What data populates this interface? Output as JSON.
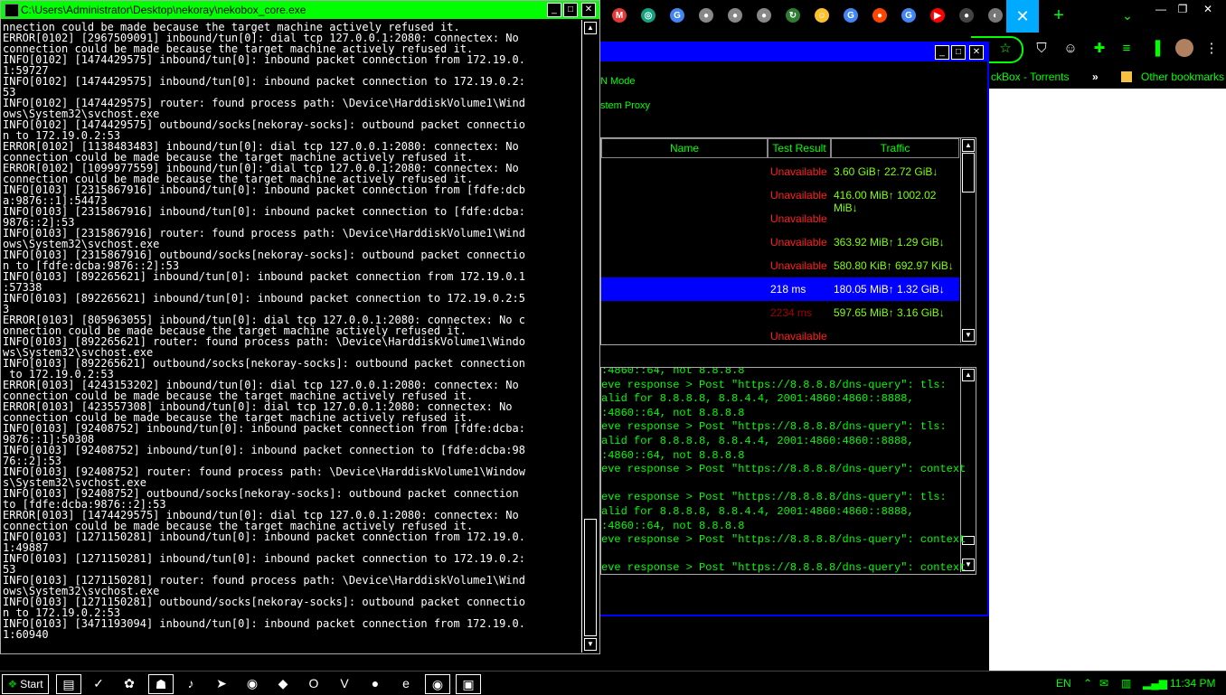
{
  "console": {
    "title": "C:\\Users\\Administrator\\Desktop\\nekoray\\nekobox_core.exe",
    "lines": [
      "nnection could be made because the target machine actively refused it.",
      "ERROR[0102] [2967509091] inbound/tun[0]: dial tcp 127.0.0.1:2080: connectex: No",
      "connection could be made because the target machine actively refused it.",
      "INFO[0102] [1474429575] inbound/tun[0]: inbound packet connection from 172.19.0.",
      "1:59727",
      "INFO[0102] [1474429575] inbound/tun[0]: inbound packet connection to 172.19.0.2:",
      "53",
      "INFO[0102] [1474429575] router: found process path: \\Device\\HarddiskVolume1\\Wind",
      "ows\\System32\\svchost.exe",
      "INFO[0102] [1474429575] outbound/socks[nekoray-socks]: outbound packet connectio",
      "n to 172.19.0.2:53",
      "ERROR[0102] [1138483483] inbound/tun[0]: dial tcp 127.0.0.1:2080: connectex: No",
      "connection could be made because the target machine actively refused it.",
      "ERROR[0102] [1099977559] inbound/tun[0]: dial tcp 127.0.0.1:2080: connectex: No",
      "connection could be made because the target machine actively refused it.",
      "INFO[0103] [2315867916] inbound/tun[0]: inbound packet connection from [fdfe:dcb",
      "a:9876::1]:54473",
      "INFO[0103] [2315867916] inbound/tun[0]: inbound packet connection to [fdfe:dcba:",
      "9876::2]:53",
      "INFO[0103] [2315867916] router: found process path: \\Device\\HarddiskVolume1\\Wind",
      "ows\\System32\\svchost.exe",
      "INFO[0103] [2315867916] outbound/socks[nekoray-socks]: outbound packet connectio",
      "n to [fdfe:dcba:9876::2]:53",
      "INFO[0103] [892265621] inbound/tun[0]: inbound packet connection from 172.19.0.1",
      ":57338",
      "INFO[0103] [892265621] inbound/tun[0]: inbound packet connection to 172.19.0.2:5",
      "3",
      "ERROR[0103] [805963055] inbound/tun[0]: dial tcp 127.0.0.1:2080: connectex: No c",
      "onnection could be made because the target machine actively refused it.",
      "INFO[0103] [892265621] router: found process path: \\Device\\HarddiskVolume1\\Windo",
      "ws\\System32\\svchost.exe",
      "INFO[0103] [892265621] outbound/socks[nekoray-socks]: outbound packet connection",
      " to 172.19.0.2:53",
      "ERROR[0103] [4243153202] inbound/tun[0]: dial tcp 127.0.0.1:2080: connectex: No",
      "connection could be made because the target machine actively refused it.",
      "ERROR[0103] [423557308] inbound/tun[0]: dial tcp 127.0.0.1:2080: connectex: No",
      "connection could be made because the target machine actively refused it.",
      "INFO[0103] [92408752] inbound/tun[0]: inbound packet connection from [fdfe:dcba:",
      "9876::1]:50308",
      "INFO[0103] [92408752] inbound/tun[0]: inbound packet connection to [fdfe:dcba:98",
      "76::2]:53",
      "INFO[0103] [92408752] router: found process path: \\Device\\HarddiskVolume1\\Window",
      "s\\System32\\svchost.exe",
      "INFO[0103] [92408752] outbound/socks[nekoray-socks]: outbound packet connection",
      "to [fdfe:dcba:9876::2]:53",
      "ERROR[0103] [1474429575] inbound/tun[0]: dial tcp 127.0.0.1:2080: connectex: No",
      "connection could be made because the target machine actively refused it.",
      "INFO[0103] [1271150281] inbound/tun[0]: inbound packet connection from 172.19.0.",
      "1:49887",
      "INFO[0103] [1271150281] inbound/tun[0]: inbound packet connection to 172.19.0.2:",
      "53",
      "INFO[0103] [1271150281] router: found process path: \\Device\\HarddiskVolume1\\Wind",
      "ows\\System32\\svchost.exe",
      "INFO[0103] [1271150281] outbound/socks[nekoray-socks]: outbound packet connectio",
      "n to 172.19.0.2:53",
      "INFO[0103] [3471193094] inbound/tun[0]: inbound packet connection from 172.19.0.",
      "1:60940"
    ]
  },
  "neko": {
    "mode_label": "N Mode",
    "proxy_label": "stem Proxy",
    "columns": [
      "Name",
      "Test Result",
      "Traffic"
    ],
    "rows": [
      {
        "result": "Unavailable",
        "result_color": "#ff2020",
        "traffic": "3.60 GiB↑ 22.72 GiB↓",
        "selected": false
      },
      {
        "result": "Unavailable",
        "result_color": "#ff2020",
        "traffic": "416.00 MiB↑ 1002.02 MiB↓",
        "selected": false
      },
      {
        "result": "Unavailable",
        "result_color": "#ff2020",
        "traffic": "",
        "selected": false
      },
      {
        "result": "Unavailable",
        "result_color": "#ff2020",
        "traffic": "363.92 MiB↑ 1.29 GiB↓",
        "selected": false
      },
      {
        "result": "Unavailable",
        "result_color": "#ff2020",
        "traffic": "580.80 KiB↑ 692.97 KiB↓",
        "selected": false
      },
      {
        "result": "218 ms",
        "result_color": "#ffffff",
        "traffic": "180.05 MiB↑ 1.32 GiB↓",
        "selected": true
      },
      {
        "result": "2234 ms",
        "result_color": "#a00000",
        "traffic": "597.65 MiB↑ 3.16 GiB↓",
        "selected": false
      },
      {
        "result": "Unavailable",
        "result_color": "#ff2020",
        "traffic": "",
        "selected": false
      }
    ],
    "log_lines": [
      ":4860::64, not 8.8.8.8",
      "eve response > Post \"https://8.8.8.8/dns-query\": tls:",
      "alid for 8.8.8.8, 8.8.4.4, 2001:4860:4860::8888,",
      ":4860::64, not 8.8.8.8",
      "eve response > Post \"https://8.8.8.8/dns-query\": tls:",
      "alid for 8.8.8.8, 8.8.4.4, 2001:4860:4860::8888,",
      ":4860::64, not 8.8.8.8",
      "eve response > Post \"https://8.8.8.8/dns-query\": context",
      "",
      "eve response > Post \"https://8.8.8.8/dns-query\": tls:",
      "alid for 8.8.8.8, 8.8.4.4, 2001:4860:4860::8888,",
      ":4860::64, not 8.8.8.8",
      "eve response > Post \"https://8.8.8.8/dns-query\": context",
      "",
      "eve response > Post \"https://8.8.8.8/dns-query\": context"
    ]
  },
  "browser": {
    "bookmarks": {
      "item": "ckBox - Torrents",
      "overflow": "»",
      "other": "Other bookmarks"
    },
    "new_tab": "+",
    "tab_menu": "⌄",
    "active_tab_close": "✕",
    "tabs": [
      {
        "icon": "gmail-icon",
        "glyph": "M",
        "color": "#e53935"
      },
      {
        "icon": "openai-icon",
        "glyph": "◎",
        "color": "#10a37f"
      },
      {
        "icon": "google-icon",
        "glyph": "G",
        "color": "#4285f4"
      },
      {
        "icon": "reddit-icon",
        "glyph": "●",
        "color": "#888888"
      },
      {
        "icon": "reddit-icon",
        "glyph": "●",
        "color": "#888888"
      },
      {
        "icon": "reddit-icon",
        "glyph": "●",
        "color": "#888888"
      },
      {
        "icon": "history-icon",
        "glyph": "↻",
        "color": "#2e7d32"
      },
      {
        "icon": "emoji-icon",
        "glyph": "☺",
        "color": "#fbc02d"
      },
      {
        "icon": "google-icon",
        "glyph": "G",
        "color": "#4285f4"
      },
      {
        "icon": "reddit-icon",
        "glyph": "●",
        "color": "#ff4500"
      },
      {
        "icon": "google-icon",
        "glyph": "G",
        "color": "#4285f4"
      },
      {
        "icon": "youtube-icon",
        "glyph": "▶",
        "color": "#ff0000"
      },
      {
        "icon": "github-icon",
        "glyph": "●",
        "color": "#444444"
      },
      {
        "icon": "web-icon",
        "glyph": "◐",
        "color": "#777777"
      }
    ]
  },
  "taskbar": {
    "start_label": "Start",
    "lang": "EN",
    "time": "11:34 PM",
    "items": [
      {
        "icon": "explorer-icon",
        "glyph": "▤",
        "boxed": true
      },
      {
        "icon": "vscode-icon",
        "glyph": "✓",
        "boxed": false
      },
      {
        "icon": "app-icon",
        "glyph": "✿",
        "boxed": false
      },
      {
        "icon": "user-icon",
        "glyph": "☗",
        "boxed": true
      },
      {
        "icon": "music-icon",
        "glyph": "♪",
        "boxed": false
      },
      {
        "icon": "telegram-icon",
        "glyph": "➤",
        "boxed": false
      },
      {
        "icon": "chrome-icon",
        "glyph": "◉",
        "boxed": false
      },
      {
        "icon": "brave-icon",
        "glyph": "◆",
        "boxed": false
      },
      {
        "icon": "opera-icon",
        "glyph": "O",
        "boxed": false
      },
      {
        "icon": "vivaldi-icon",
        "glyph": "V",
        "boxed": false
      },
      {
        "icon": "firefox-icon",
        "glyph": "●",
        "boxed": false
      },
      {
        "icon": "edge-icon",
        "glyph": "e",
        "boxed": false
      },
      {
        "icon": "chrome-icon",
        "glyph": "◉",
        "boxed": true
      },
      {
        "icon": "window-icon",
        "glyph": "▣",
        "boxed": true
      }
    ]
  }
}
